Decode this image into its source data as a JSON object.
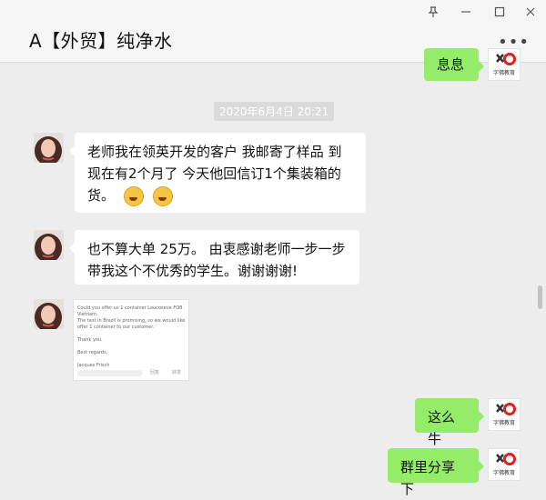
{
  "window": {
    "title": "A【外贸】纯净水",
    "pin_icon": "pin-icon",
    "minimize_icon": "minimize-icon",
    "maximize_icon": "maximize-icon",
    "close_icon": "close-icon",
    "more_label": "•••"
  },
  "chat": {
    "top_partial_message": "息息",
    "timestamp": "2020年6月4日 20:21",
    "messages": [
      {
        "sender": "them",
        "text": "老师我在领英开发的客户 我邮寄了样品  到现在有2个月了 今天他回信订1个集装箱的货。",
        "emojis": 2
      },
      {
        "sender": "them",
        "text": "也不算大单 25万。  由衷感谢老师一步一步带我这个不优秀的学生。谢谢谢谢!"
      },
      {
        "sender": "them",
        "type": "image",
        "lines": [
          "Could you offer us 1 container Leucoseve FOB",
          "Vietnam.",
          "The test in Brazil is promising, so we would like to",
          "offer 1 container to our customer.",
          "",
          "Thank you.",
          "",
          "Best regards,",
          "",
          "Jacques Frisch"
        ],
        "reply_actions": [
          "回复",
          "转发"
        ]
      },
      {
        "sender": "me",
        "text": "这么牛"
      },
      {
        "sender": "me",
        "text": "群里分享下"
      }
    ],
    "my_avatar_text": "字佛教育"
  },
  "colors": {
    "my_bubble": "#95ec69",
    "their_bubble": "#ffffff",
    "background": "#ededed"
  }
}
